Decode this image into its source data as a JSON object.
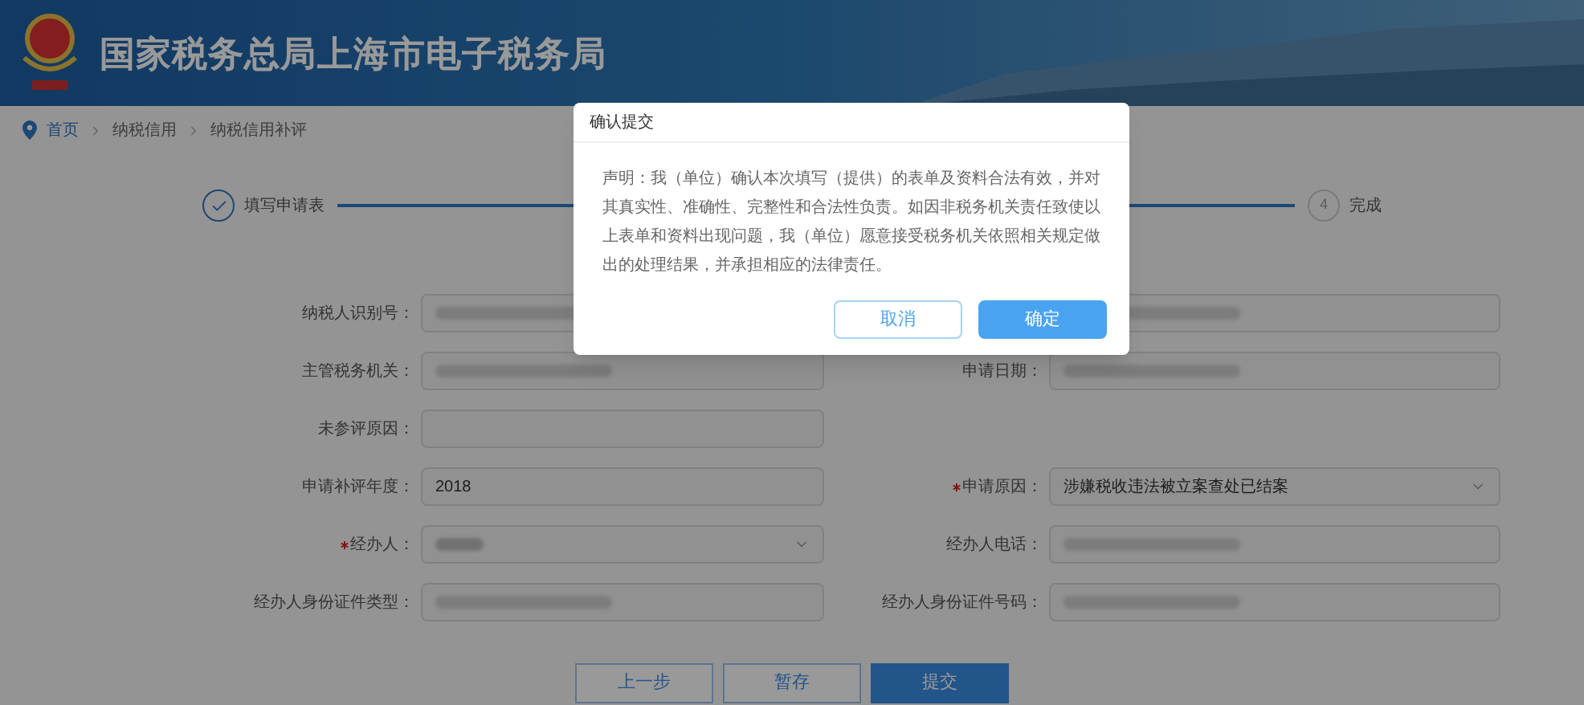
{
  "header": {
    "title": "国家税务总局上海市电子税务局"
  },
  "breadcrumb": [
    "首页",
    "纳税信用",
    "纳税信用补评"
  ],
  "steps": [
    {
      "label": "填写申请表",
      "done": true
    },
    {
      "number": "4",
      "label": "完成",
      "done": false
    }
  ],
  "form": {
    "rows": [
      {
        "left": {
          "label": "纳税人识别号：",
          "required": false,
          "kind": "redacted"
        },
        "right": {
          "kind": "redacted"
        }
      },
      {
        "left": {
          "label": "主管税务机关：",
          "required": false,
          "kind": "redacted"
        },
        "right": {
          "label": "申请日期：",
          "required": false,
          "kind": "redacted"
        }
      },
      {
        "left": {
          "label": "未参评原因：",
          "required": false,
          "kind": "text"
        }
      },
      {
        "left": {
          "label": "申请补评年度：",
          "required": false,
          "kind": "text",
          "value": "2018"
        },
        "right": {
          "label": "申请原因：",
          "required": true,
          "kind": "select",
          "value": "涉嫌税收违法被立案查处已结案"
        }
      },
      {
        "left": {
          "label": "经办人：",
          "required": true,
          "kind": "select-redacted"
        },
        "right": {
          "label": "经办人电话：",
          "required": false,
          "kind": "redacted"
        }
      },
      {
        "left": {
          "label": "经办人身份证件类型：",
          "required": false,
          "kind": "redacted"
        },
        "right": {
          "label": "经办人身份证件号码：",
          "required": false,
          "kind": "redacted"
        }
      }
    ]
  },
  "actions": [
    {
      "label": "上一步",
      "primary": false
    },
    {
      "label": "暂存",
      "primary": false
    },
    {
      "label": "提交",
      "primary": true
    }
  ],
  "dialog": {
    "title": "确认提交",
    "message": "声明：我（单位）确认本次填写（提供）的表单及资料合法有效，并对其真实性、准确性、完整性和合法性负责。如因非税务机关责任致使以上表单和资料出现问题，我（单位）愿意接受税务机关依照相关规定做出的处理结果，并承担相应的法律责任。",
    "buttons": [
      {
        "label": "取消",
        "primary": false
      },
      {
        "label": "确定",
        "primary": true
      }
    ]
  }
}
